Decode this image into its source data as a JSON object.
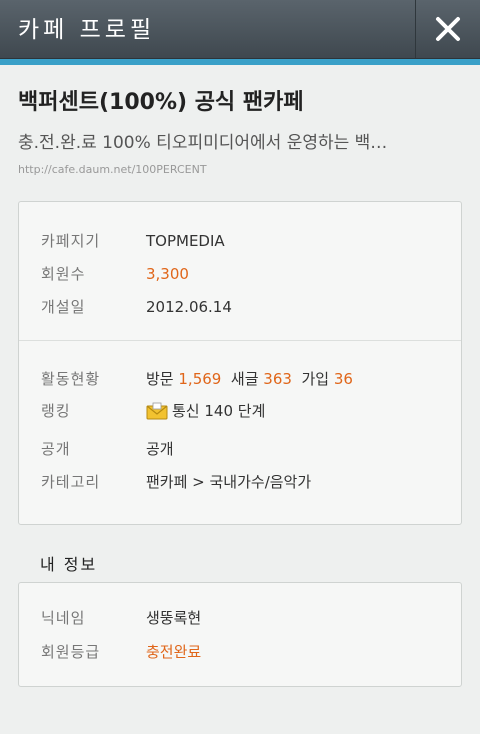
{
  "header": {
    "title": "카페 프로필"
  },
  "cafe": {
    "title": "백퍼센트(100%) 공식 팬카페",
    "description": "충.전.완.료 100% 티오피미디어에서 운영하는 백…",
    "url": "http://cafe.daum.net/100PERCENT"
  },
  "info": {
    "owner_label": "카페지기",
    "owner_value": "TOPMEDIA",
    "members_label": "회원수",
    "members_value": "3,300",
    "opened_label": "개설일",
    "opened_value": "2012.06.14"
  },
  "activity": {
    "label": "활동현황",
    "visit_label": "방문",
    "visit_value": "1,569",
    "post_label": "새글",
    "post_value": "363",
    "join_label": "가입",
    "join_value": "36"
  },
  "ranking": {
    "label": "랭킹",
    "value": "통신 140 단계"
  },
  "visibility": {
    "label": "공개",
    "value": "공개"
  },
  "category": {
    "label": "카테고리",
    "value": "팬카페 > 국내가수/음악가"
  },
  "my_info": {
    "title": "내 정보",
    "nickname_label": "닉네임",
    "nickname_value": "생뚱록현",
    "grade_label": "회원등급",
    "grade_value": "충전완료"
  },
  "colors": {
    "accent": "#3aa0c8",
    "highlight": "#e0661a",
    "header": "#4a535a"
  }
}
